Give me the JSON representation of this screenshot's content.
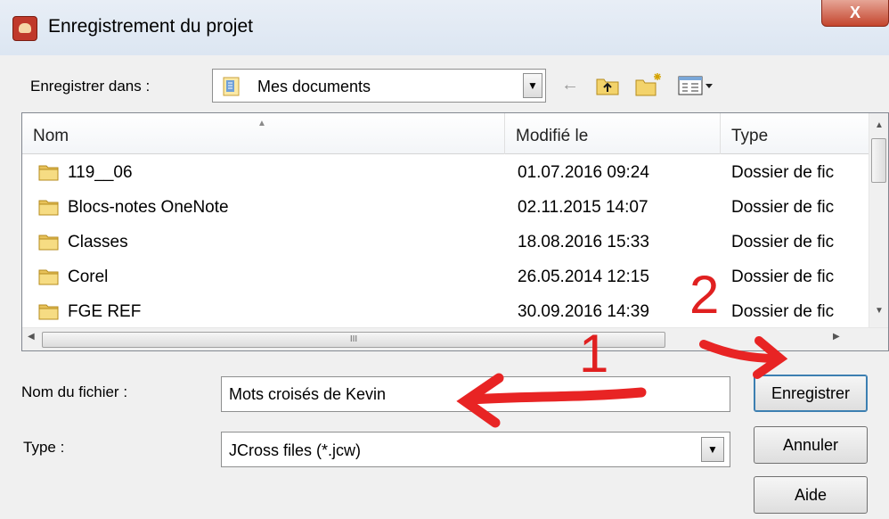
{
  "window": {
    "title": "Enregistrement du projet",
    "close_glyph": "X"
  },
  "save_in": {
    "label": "Enregistrer dans :",
    "value": "Mes documents"
  },
  "toolbar": {
    "icons": [
      "back-arrow-icon",
      "up-folder-icon",
      "new-folder-icon",
      "view-menu-icon"
    ]
  },
  "file_list": {
    "columns": [
      "Nom",
      "Modifié le",
      "Type"
    ],
    "rows": [
      {
        "name": "119__06",
        "modified": "01.07.2016 09:24",
        "type": "Dossier de fic"
      },
      {
        "name": "Blocs-notes OneNote",
        "modified": "02.11.2015 14:07",
        "type": "Dossier de fic"
      },
      {
        "name": "Classes",
        "modified": "18.08.2016 15:33",
        "type": "Dossier de fic"
      },
      {
        "name": "Corel",
        "modified": "26.05.2014 12:15",
        "type": "Dossier de fic"
      },
      {
        "name": "FGE REF",
        "modified": "30.09.2016 14:39",
        "type": "Dossier de fic"
      }
    ],
    "hscroll_thumb_glyph": "III"
  },
  "filename": {
    "label": "Nom du fichier :",
    "value": "Mots croisés de Kevin"
  },
  "filetype": {
    "label": "Type :",
    "value": "JCross files (*.jcw)"
  },
  "buttons": {
    "save": "Enregistrer",
    "cancel": "Annuler",
    "help": "Aide"
  },
  "annotations": {
    "step1": "1",
    "step2": "2",
    "color": "#e02020"
  }
}
